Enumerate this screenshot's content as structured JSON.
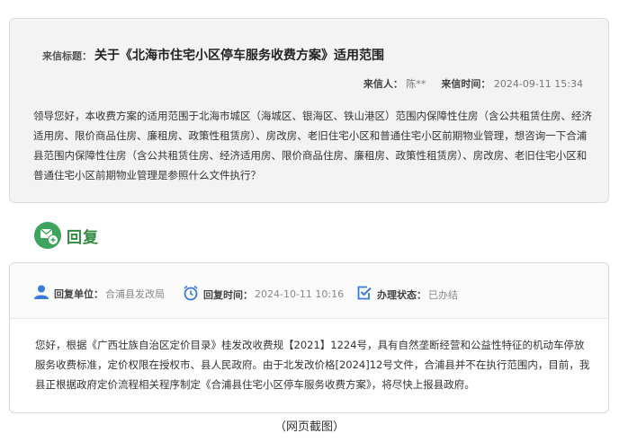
{
  "letter": {
    "title_label": "来信标题：",
    "title": "关于《北海市住宅小区停车服务收费方案》适用范围",
    "sender_label": "来信人：",
    "sender": "陈**",
    "time_label": "来信时间：",
    "time": "2024-09-11 15:34",
    "body": "领导您好，本收费方案的适用范围于北海市城区（海城区、银海区、铁山港区）范围内保障性住房（含公共租赁住房、经济适用房、限价商品住房、廉租房、政策性租赁房）、房改房、老旧住宅小区和普通住宅小区前期物业管理，想咨询一下合浦县范围内保障性住房（含公共租赁住房、经济适用房、限价商品住房、廉租房、政策性租赁房）、房改房、老旧住宅小区和普通住宅小区前期物业管理是参照什么文件执行？"
  },
  "reply": {
    "header_label": "回复",
    "unit_label": "回复单位：",
    "unit": "合浦县发改局",
    "time_label": "回复时间：",
    "time": "2024-10-11 10:16",
    "status_label": "办理状态：",
    "status": "已办结",
    "body": "您好，根据《广西壮族自治区定价目录》桂发改收费规【2021】1224号，具有自然垄断经营和公益性特征的机动车停放服务收费标准，定价权限在授权市、县人民政府。由于北发改价格[2024]12号文件，合浦县并不在执行范围内，目前，我县正根据政府定价流程相关程序制定《合浦县住宅小区停车服务收费方案》，将尽快上报县政府。"
  },
  "caption": "（网页截图）",
  "colors": {
    "accent_green": "#3da35d",
    "icon_blue": "#3a7bd5"
  }
}
